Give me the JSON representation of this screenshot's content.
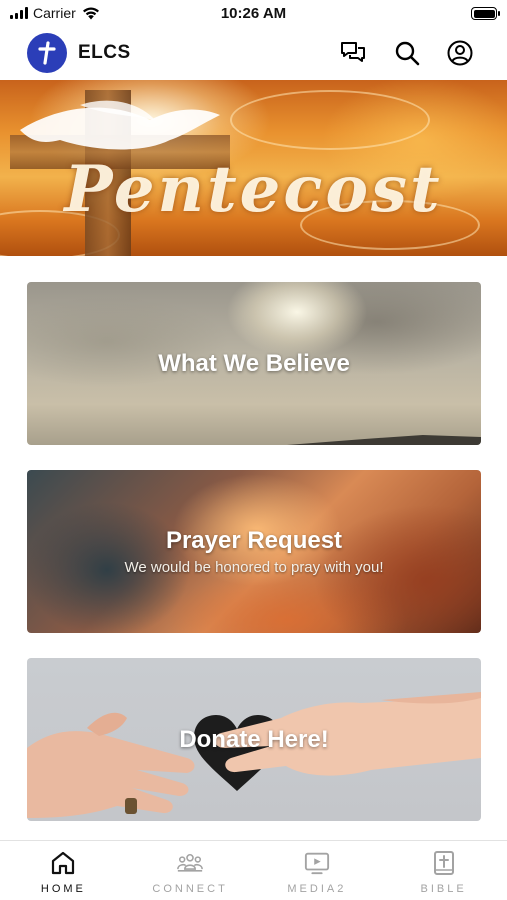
{
  "status_bar": {
    "carrier": "Carrier",
    "time": "10:26 AM"
  },
  "header": {
    "app_title": "ELCS",
    "logo_icon": "cross-icon",
    "icons": [
      "chat-bubbles-icon",
      "search-icon",
      "profile-icon"
    ],
    "logo_color": "#2b3eb8"
  },
  "hero": {
    "banner_text": "Pentecost"
  },
  "cards": [
    {
      "title": "What We Believe",
      "subtitle": ""
    },
    {
      "title": "Prayer Request",
      "subtitle": "We would be honored to pray with you!"
    },
    {
      "title": "Donate Here!",
      "subtitle": ""
    }
  ],
  "tabbar": {
    "active_color": "#111111",
    "inactive_color": "#a3a3a3",
    "tabs": [
      {
        "label": "HOME",
        "icon": "home-icon",
        "active": true
      },
      {
        "label": "CONNECT",
        "icon": "people-icon",
        "active": false
      },
      {
        "label": "MEDIA2",
        "icon": "tv-play-icon",
        "active": false
      },
      {
        "label": "BIBLE",
        "icon": "bible-icon",
        "active": false
      }
    ]
  }
}
